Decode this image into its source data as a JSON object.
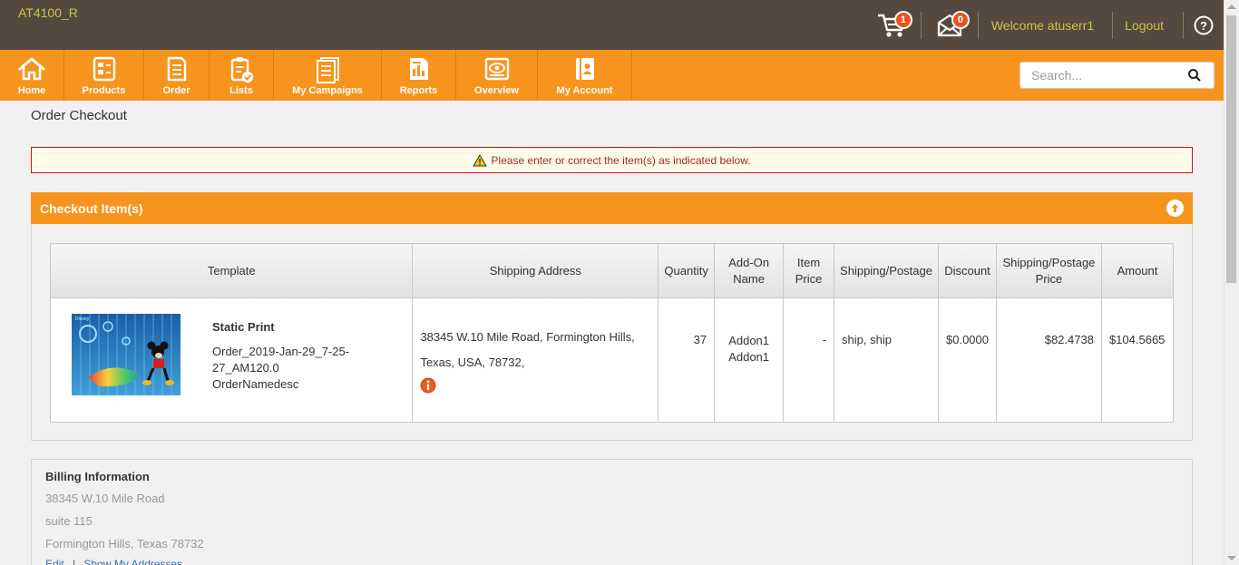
{
  "header": {
    "brand": "AT4100_R",
    "cart_count": "1",
    "messages_count": "0",
    "welcome": "Welcome atuserr1",
    "logout": "Logout"
  },
  "nav": {
    "items": [
      {
        "label": "Home",
        "icon": "home-icon"
      },
      {
        "label": "Products",
        "icon": "products-icon"
      },
      {
        "label": "Order",
        "icon": "order-icon"
      },
      {
        "label": "Lists",
        "icon": "lists-icon"
      },
      {
        "label": "My Campaigns",
        "icon": "campaigns-icon"
      },
      {
        "label": "Reports",
        "icon": "reports-icon"
      },
      {
        "label": "Overview",
        "icon": "overview-icon"
      },
      {
        "label": "My Account",
        "icon": "account-icon"
      }
    ],
    "search_placeholder": "Search..."
  },
  "page": {
    "title": "Order Checkout",
    "alert": "Please enter or correct the item(s) as indicated below."
  },
  "checkout": {
    "heading": "Checkout Item(s)",
    "columns": [
      "Template",
      "Shipping Address",
      "Quantity",
      "Add-On Name",
      "Item Price",
      "Shipping/Postage",
      "Discount",
      "Shipping/Postage Price",
      "Amount"
    ],
    "row": {
      "template_title": "Static Print",
      "template_desc": "Order_2019-Jan-29_7-25-27_AM120.0 OrderNamedesc",
      "address_line1": "38345 W.10 Mile Road, Formington Hills,",
      "address_line2": "Texas, USA, 78732,",
      "quantity": "37",
      "addon_1": "Addon1",
      "addon_2": "Addon1",
      "item_price": "-",
      "shipping_postage": "ship, ship",
      "discount": "$0.0000",
      "shipping_price": "$82.4738",
      "amount": "$104.5665"
    }
  },
  "billing": {
    "heading": "Billing Information",
    "line1": "38345 W.10 Mile Road",
    "line2": "suite 115",
    "line3": "Formington Hills, Texas 78732",
    "edit": "Edit",
    "show_addresses": "Show My Addresses"
  },
  "colors": {
    "topbar": "#54483f",
    "accent_orange": "#f7941d",
    "brand_text": "#c9c74b",
    "badge": "#e8531c"
  }
}
